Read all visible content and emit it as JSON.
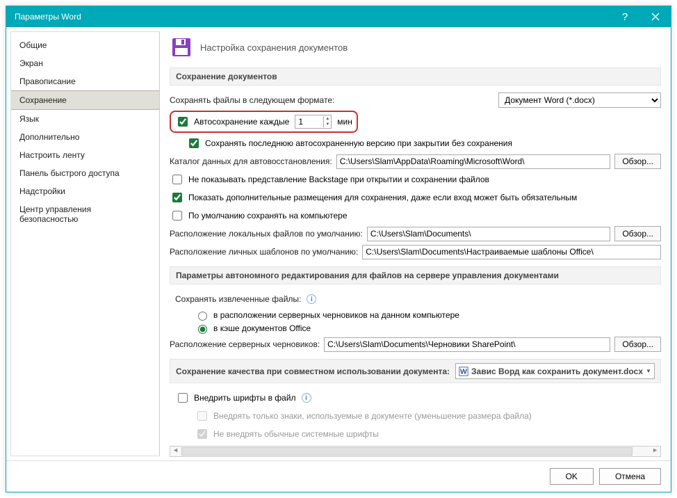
{
  "window": {
    "title": "Параметры Word"
  },
  "sidebar": {
    "items": [
      {
        "label": "Общие"
      },
      {
        "label": "Экран"
      },
      {
        "label": "Правописание"
      },
      {
        "label": "Сохранение"
      },
      {
        "label": "Язык"
      },
      {
        "label": "Дополнительно"
      },
      {
        "label": "Настроить ленту"
      },
      {
        "label": "Панель быстрого доступа"
      },
      {
        "label": "Надстройки"
      },
      {
        "label": "Центр управления безопасностью"
      }
    ],
    "selected_index": 3
  },
  "header": {
    "title": "Настройка сохранения документов"
  },
  "section_save": {
    "title": "Сохранение документов",
    "format_label": "Сохранять файлы в следующем формате:",
    "format_value": "Документ Word (*.docx)",
    "autosave_label": "Автосохранение каждые",
    "autosave_value": "1",
    "autosave_unit": "мин",
    "keep_last_label": "Сохранять последнюю автосохраненную версию при закрытии без сохранения",
    "autorecover_dir_label": "Каталог данных для автовосстановления:",
    "autorecover_dir_value": "C:\\Users\\Slam\\AppData\\Roaming\\Microsoft\\Word\\",
    "no_backstage_label": "Не показывать представление Backstage при открытии и сохранении файлов",
    "show_extra_label": "Показать дополнительные размещения для сохранения, даже если вход может быть обязательным",
    "default_pc_label": "По умолчанию сохранять на компьютере",
    "local_loc_label": "Расположение локальных файлов по умолчанию:",
    "local_loc_value": "C:\\Users\\Slam\\Documents\\",
    "templates_label": "Расположение личных шаблонов по умолчанию:",
    "templates_value": "C:\\Users\\Slam\\Documents\\Настраиваемые шаблоны Office\\",
    "browse_label": "Обзор..."
  },
  "section_offline": {
    "title": "Параметры автономного редактирования для файлов на сервере управления документами",
    "extracted_label": "Сохранять извлеченные файлы:",
    "radio_server": "в расположении серверных черновиков на данном компьютере",
    "radio_cache": "в кэше документов Office",
    "drafts_label": "Расположение серверных черновиков:",
    "drafts_value": "C:\\Users\\Slam\\Documents\\Черновики SharePoint\\",
    "browse_label": "Обзор..."
  },
  "section_quality": {
    "title": "Сохранение качества при совместном использовании документа:",
    "doc_value": "Завис Ворд как сохранить документ.docx",
    "embed_fonts_label": "Внедрить шрифты в файл",
    "embed_used_label": "Внедрять только знаки, используемые в документе (уменьшение размера файла)",
    "skip_system_label": "Не внедрять обычные системные шрифты"
  },
  "footer": {
    "ok": "OK",
    "cancel": "Отмена"
  }
}
